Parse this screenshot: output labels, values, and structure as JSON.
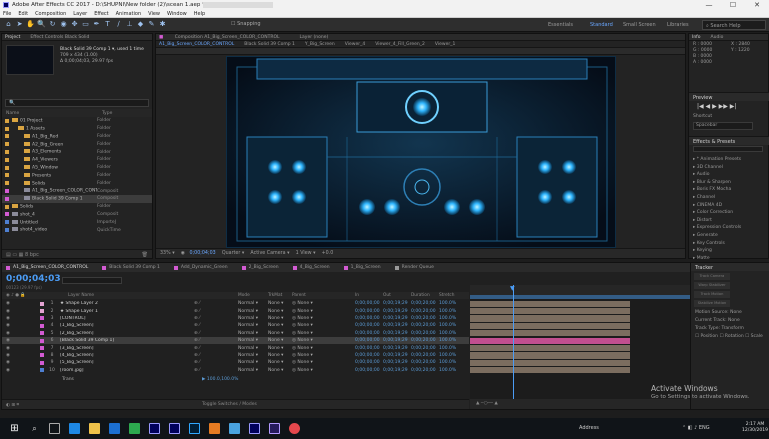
{
  "window": {
    "title": "Adobe After Effects CC 2017 - D:\\SHUPNI\\New folder (2)\\scean 1.aep *",
    "controls": [
      "—",
      "☐",
      "✕"
    ]
  },
  "menu": [
    "File",
    "Edit",
    "Composition",
    "Layer",
    "Effect",
    "Animation",
    "View",
    "Window",
    "Help"
  ],
  "toolbar": {
    "snapping": "Snapping",
    "workspaces": [
      "Essentials",
      "Standard",
      "Small Screen",
      "Libraries"
    ],
    "active_workspace": "Standard",
    "search_placeholder": "Search Help"
  },
  "project_panel": {
    "tabs": [
      "Project",
      "Effect Controls Black Solid"
    ],
    "selected_item": "Black Solid 39 Comp 1 ▾, used 1 time",
    "meta_line1": "709 x 434 (1.00)",
    "meta_line2": "Δ 0;00;04;03, 29.97 fps",
    "search_placeholder": "🔍",
    "col_name": "Name",
    "col_type": "Type",
    "items": [
      {
        "name": "01 Project",
        "type": "Folder",
        "color": "#d9a441",
        "kind": "folder"
      },
      {
        "name": "1 Assets",
        "type": "Folder",
        "color": "#d9a441",
        "kind": "folder"
      },
      {
        "name": "A1_Big_Red",
        "type": "Folder",
        "color": "#d9a441",
        "kind": "folder"
      },
      {
        "name": "A2_Big_Green",
        "type": "Folder",
        "color": "#d9a441",
        "kind": "folder"
      },
      {
        "name": "A3_Elements",
        "type": "Folder",
        "color": "#d9a441",
        "kind": "folder"
      },
      {
        "name": "A4_Viewers",
        "type": "Folder",
        "color": "#d9a441",
        "kind": "folder"
      },
      {
        "name": "A5_Window",
        "type": "Folder",
        "color": "#d9a441",
        "kind": "folder"
      },
      {
        "name": "Presents",
        "type": "Folder",
        "color": "#d9a441",
        "kind": "folder"
      },
      {
        "name": "Solids",
        "type": "Folder",
        "color": "#d9a441",
        "kind": "folder"
      },
      {
        "name": "A1_Big_Screen_COLOR_CONTROL",
        "type": "Composit",
        "color": "#d35bd3",
        "kind": "comp"
      },
      {
        "name": "Black Solid 39 Comp 1",
        "type": "Composit",
        "color": "#d35bd3",
        "kind": "comp",
        "selected": true
      },
      {
        "name": "Solids",
        "type": "Folder",
        "color": "#d9a441",
        "kind": "folder"
      },
      {
        "name": "shot_4",
        "type": "Composit",
        "color": "#d35bd3",
        "kind": "comp"
      },
      {
        "name": "Untitled",
        "type": "ImporteJ",
        "color": "#4e7fd1",
        "kind": "comp"
      },
      {
        "name": "shot4_video",
        "type": "QuickTime",
        "color": "#4e7fd1",
        "kind": "comp"
      }
    ],
    "footer": "8 bpc"
  },
  "comp_panel": {
    "tabs": [
      "Composition A1_Big_Screen_COLOR_CONTROL",
      "Layer (none)"
    ],
    "breadcrumbs": [
      "A1_Big_Screen_COLOR_CONTROL",
      "Black Solid 39 Comp 1",
      "Y_Big_Screen",
      "Viewer_4",
      "Viewer_4_Fill_Green_2",
      "Viewer_1"
    ],
    "zoom": "33%",
    "timecode": "0;00;04;03",
    "quality": "Quarter",
    "camera": "Active Camera",
    "views": "1 View",
    "exposure": "+0.0"
  },
  "right_panel": {
    "info_tab": "Info",
    "audio_tab": "Audio",
    "info_lines": [
      "R : 0000",
      "G : 0000",
      "B : 0000",
      "A : 0000"
    ],
    "info_coords": [
      "X : 2840",
      "Y : 1220"
    ],
    "preview_title": "Preview",
    "preview_controls": "|◀  ◀  ▶  ▶▶  ▶|",
    "shortcut_label": "Shortcut",
    "shortcut_value": "Spacebar",
    "effects_title": "Effects & Presets",
    "effects_items": [
      "* Animation Presets",
      "3D Channel",
      "Audio",
      "Blur & Sharpen",
      "Boris FX Mocha",
      "Channel",
      "CINEMA 4D",
      "Color Correction",
      "Distort",
      "Expression Controls",
      "Generate",
      "Key Controls",
      "Keying",
      "Matte"
    ]
  },
  "timeline": {
    "tabs": [
      {
        "name": "A1_Big_Screen_COLOR_CONTROL",
        "color": "#d35bd3",
        "active": true
      },
      {
        "name": "Black Solid 39 Comp 1",
        "color": "#d35bd3"
      },
      {
        "name": "Add_Dynamic_Green",
        "color": "#d35bd3"
      },
      {
        "name": "2_Big_Screen",
        "color": "#d35bd3"
      },
      {
        "name": "4_Big_Screen",
        "color": "#d35bd3"
      },
      {
        "name": "1_Big_Screen",
        "color": "#d35bd3"
      },
      {
        "name": "Render Queue",
        "color": "#9a9a9a"
      }
    ],
    "timecode": "0;00;04;03",
    "frames": "00123 (29.97 fps)",
    "columns": {
      "name": "Layer Name",
      "mode": "Mode",
      "trkmat": "TrkMat",
      "parent": "Parent",
      "in": "In",
      "out": "Out",
      "duration": "Duration",
      "stretch": "Stretch"
    },
    "layers": [
      {
        "num": "1",
        "name": "★ Shape Layer 2",
        "color": "#e4a3d2",
        "mode": "Normal",
        "trk": "None",
        "parent": "None"
      },
      {
        "num": "2",
        "name": "★ Shape Layer 1",
        "color": "#e4a3d2",
        "mode": "Normal",
        "trk": "None",
        "parent": "None"
      },
      {
        "num": "3",
        "name": "[CONTROL]",
        "color": "#d35bd3",
        "mode": "Normal",
        "trk": "None",
        "parent": "None"
      },
      {
        "num": "4",
        "name": "[1_Big_Screen]",
        "color": "#d35bd3",
        "mode": "Normal",
        "trk": "None",
        "parent": "None"
      },
      {
        "num": "5",
        "name": "[2_Big_Screen]",
        "color": "#d35bd3",
        "mode": "Normal",
        "trk": "None",
        "parent": "None"
      },
      {
        "num": "6",
        "name": "[Black Solid 39 Comp 1]",
        "color": "#d35bd3",
        "mode": "Normal",
        "trk": "None",
        "parent": "None",
        "selected": true
      },
      {
        "num": "7",
        "name": "[3_Big_Screen]",
        "color": "#d35bd3",
        "mode": "Normal",
        "trk": "None",
        "parent": "None"
      },
      {
        "num": "8",
        "name": "[4_Big_Screen]",
        "color": "#d35bd3",
        "mode": "Normal",
        "trk": "None",
        "parent": "None"
      },
      {
        "num": "9",
        "name": "[5_Big_Screen]",
        "color": "#d35bd3",
        "mode": "Normal",
        "trk": "None",
        "parent": "None"
      },
      {
        "num": "10",
        "name": "[room.jpg]",
        "color": "#4e7fd1",
        "mode": "Normal",
        "trk": "None",
        "parent": "None"
      }
    ],
    "in_time": "0;00;00;00",
    "out_time": "0;00;19;29",
    "duration": "0;00;20;00",
    "stretch": "100.0%",
    "sub_row": "Trans",
    "sub_value": "▶ 100.0,100.0%",
    "toggle_label": "Toggle Switches / Modes"
  },
  "tracker_panel": {
    "title": "Tracker",
    "buttons": [
      "Track Camera",
      "Warp Stabilizer",
      "Track Motion",
      "Stabilize Motion"
    ],
    "lines": [
      "Motion Source: None",
      "Current Track: None",
      "Track Type:  Transform"
    ],
    "checks": [
      "Position",
      "Rotation",
      "Scale"
    ]
  },
  "activation": {
    "title": "Activate Windows",
    "subtitle": "Go to Settings to activate Windows."
  },
  "taskbar": {
    "search_hint": "Address",
    "time": "2:17 AM",
    "date": "12/30/2019"
  }
}
